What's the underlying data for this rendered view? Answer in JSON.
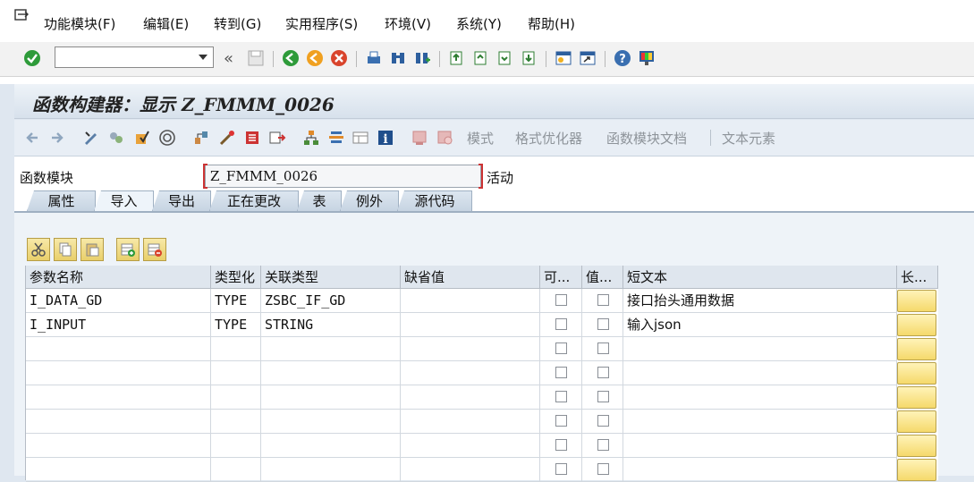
{
  "menu": {
    "items": [
      "功能模块(F)",
      "编辑(E)",
      "转到(G)",
      "实用程序(S)",
      "环境(V)",
      "系统(Y)",
      "帮助(H)"
    ]
  },
  "toolbar": {
    "command_value": "",
    "back_symbol": "«"
  },
  "title": "函数构建器：显示 Z_FMMM_0026",
  "app_toolbar": {
    "text_buttons": [
      "模式",
      "格式优化器",
      "函数模块文档",
      "文本元素"
    ]
  },
  "function_module": {
    "label": "函数模块",
    "name": "Z_FMMM_0026",
    "status": "活动"
  },
  "tabs": [
    "属性",
    "导入",
    "导出",
    "正在更改",
    "表",
    "例外",
    "源代码"
  ],
  "active_tab": "导入",
  "grid": {
    "columns": [
      "参数名称",
      "类型化",
      "关联类型",
      "缺省值",
      "可...",
      "值...",
      "短文本",
      "长..."
    ],
    "rows": [
      {
        "name": "I_DATA_GD",
        "typing": "TYPE",
        "ref_type": "ZSBC_IF_GD",
        "default": "",
        "optional": false,
        "pass_value": false,
        "short_text": "接口抬头通用数据"
      },
      {
        "name": "I_INPUT",
        "typing": "TYPE",
        "ref_type": "STRING",
        "default": "",
        "optional": false,
        "pass_value": false,
        "short_text": "输入json"
      },
      {
        "name": "",
        "typing": "",
        "ref_type": "",
        "default": "",
        "optional": false,
        "pass_value": false,
        "short_text": ""
      },
      {
        "name": "",
        "typing": "",
        "ref_type": "",
        "default": "",
        "optional": false,
        "pass_value": false,
        "short_text": ""
      },
      {
        "name": "",
        "typing": "",
        "ref_type": "",
        "default": "",
        "optional": false,
        "pass_value": false,
        "short_text": ""
      },
      {
        "name": "",
        "typing": "",
        "ref_type": "",
        "default": "",
        "optional": false,
        "pass_value": false,
        "short_text": ""
      },
      {
        "name": "",
        "typing": "",
        "ref_type": "",
        "default": "",
        "optional": false,
        "pass_value": false,
        "short_text": ""
      },
      {
        "name": "",
        "typing": "",
        "ref_type": "",
        "default": "",
        "optional": false,
        "pass_value": false,
        "short_text": ""
      }
    ]
  },
  "colors": {
    "accent_green": "#2e9b3a",
    "field_button_yellow": "#f5d96b",
    "required_mark_red": "#cc3333"
  }
}
